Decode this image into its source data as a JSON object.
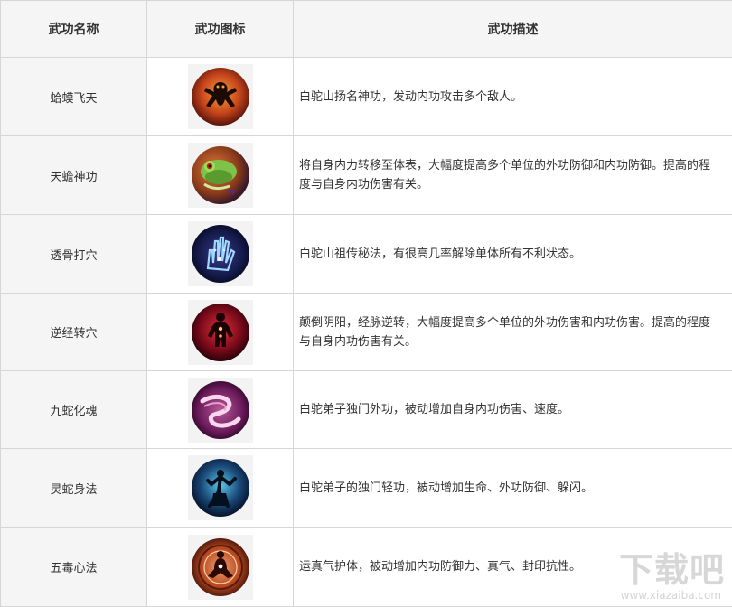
{
  "headers": {
    "name": "武功名称",
    "icon": "武功图标",
    "desc": "武功描述"
  },
  "rows": [
    {
      "name": "蛤蟆飞天",
      "icon": "toad-icon",
      "desc": "白驼山扬名神功，发动内功攻击多个敌人。"
    },
    {
      "name": "天蟾神功",
      "icon": "frog-icon",
      "desc": "将自身内力转移至体表，大幅度提高多个单位的外功防御和内功防御。提高的程度与自身内功伤害有关。"
    },
    {
      "name": "透骨打穴",
      "icon": "palm-icon",
      "desc": "白驼山祖传秘法，有很高几率解除单体所有不利状态。"
    },
    {
      "name": "逆经转穴",
      "icon": "meridian-icon",
      "desc": "颠倒阴阳，经脉逆转，大幅度提高多个单位的外功伤害和内功伤害。提高的程度与自身内功伤害有关。"
    },
    {
      "name": "九蛇化魂",
      "icon": "serpent-icon",
      "desc": "白驼弟子独门外功，被动增加自身内功伤害、速度。"
    },
    {
      "name": "灵蛇身法",
      "icon": "agile-figure-icon",
      "desc": "白驼弟子的独门轻功，被动增加生命、外功防御、躲闪。"
    },
    {
      "name": "五毒心法",
      "icon": "meditation-icon",
      "desc": "运真气护体，被动增加内功防御力、真气、封印抗性。"
    }
  ],
  "watermark": {
    "main": "下载吧",
    "sub": "www.xiazaiba.com"
  }
}
